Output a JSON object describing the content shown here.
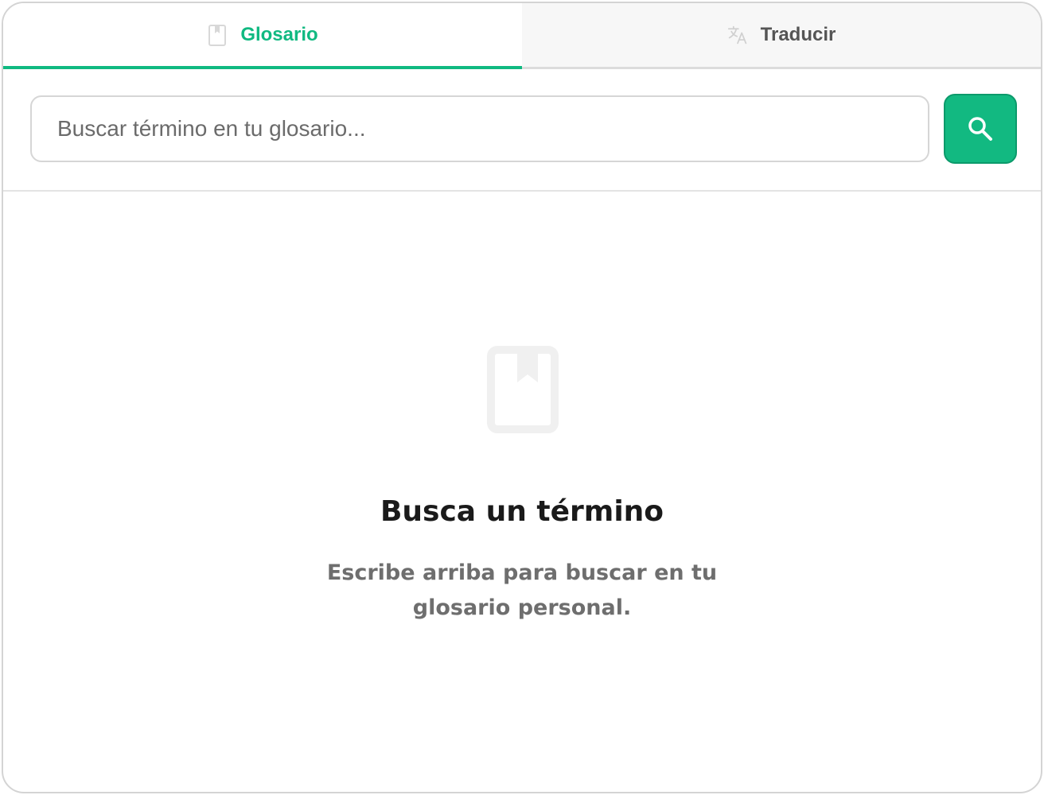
{
  "tabs": [
    {
      "label": "Glosario",
      "icon": "bookmark-icon",
      "active": true
    },
    {
      "label": "Traducir",
      "icon": "translate-icon",
      "active": false
    }
  ],
  "search": {
    "placeholder": "Buscar término en tu glosario...",
    "value": "",
    "button_icon": "search-icon"
  },
  "empty_state": {
    "icon": "bookmark-icon",
    "title": "Busca un término",
    "description": "Escribe arriba para buscar en tu glosario personal."
  },
  "colors": {
    "accent": "#10b981",
    "inactive_tab_bg": "#f7f7f7",
    "border": "#d4d4d4",
    "muted_text": "#6e6e6e",
    "title_text": "#1a1a1a",
    "icon_muted": "#f0f0f0"
  }
}
